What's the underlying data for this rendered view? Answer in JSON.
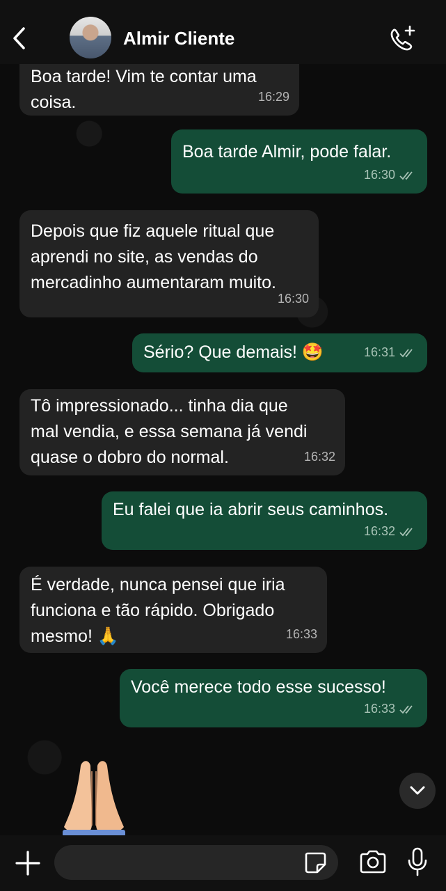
{
  "header": {
    "contact_name": "Almir Cliente"
  },
  "messages": [
    {
      "direction": "in",
      "text": "Boa tarde! Vim te contar uma\ncoisa.",
      "time": "16:29"
    },
    {
      "direction": "out",
      "text": "Boa tarde Almir, pode falar.",
      "time": "16:30",
      "status": "read"
    },
    {
      "direction": "in",
      "text": "Depois que fiz aquele ritual que\naprendi no site, as vendas do\nmercadinho aumentaram muito.",
      "time": "16:30"
    },
    {
      "direction": "out",
      "text": "Sério? Que demais! 🤩",
      "time": "16:31",
      "status": "read"
    },
    {
      "direction": "in",
      "text": "Tô impressionado... tinha dia que\nmal vendia, e essa semana já vendi\nquase o dobro do normal.",
      "time": "16:32"
    },
    {
      "direction": "out",
      "text": "Eu falei que ia abrir seus caminhos.",
      "time": "16:32",
      "status": "read"
    },
    {
      "direction": "in",
      "text": "É verdade, nunca pensei que iria\nfunciona e tão rápido. Obrigado\nmesmo! 🙏",
      "time": "16:33"
    },
    {
      "direction": "out",
      "text": "Você merece todo esse sucesso!",
      "time": "16:33",
      "status": "read"
    }
  ],
  "sticker": {
    "icon": "praying-hands"
  },
  "composer": {
    "placeholder": ""
  },
  "colors": {
    "incoming_bubble": "#232323",
    "outgoing_bubble": "#144d37",
    "background": "#0c0c0c",
    "header": "#111111"
  }
}
